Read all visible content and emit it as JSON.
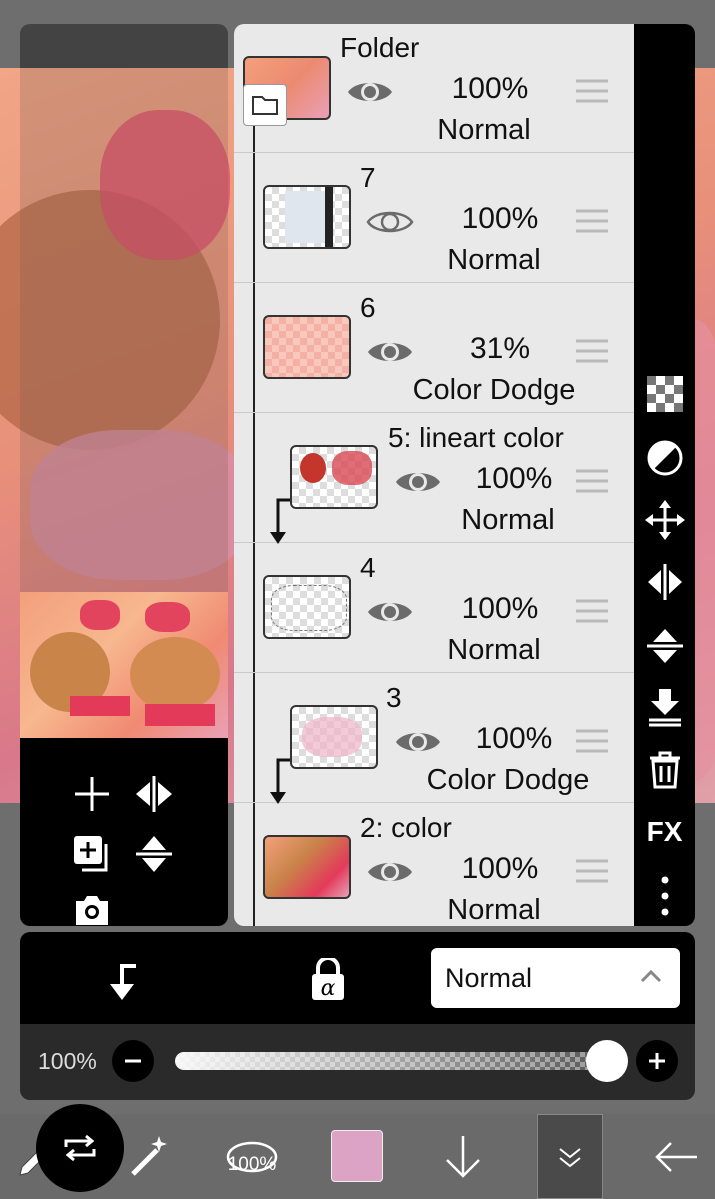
{
  "colors": {
    "panel_bg": "#e9e9e9",
    "toolbar_bg": "#000000",
    "current_color": "#dca3c4"
  },
  "layers": [
    {
      "name": "Folder",
      "opacity": "100%",
      "blend": "Normal",
      "is_folder": true,
      "visible": true
    },
    {
      "name": "7",
      "opacity": "100%",
      "blend": "Normal",
      "visible": false
    },
    {
      "name": "6",
      "opacity": "31%",
      "blend": "Color Dodge",
      "visible": true
    },
    {
      "name": "5: lineart color",
      "opacity": "100%",
      "blend": "Normal",
      "clipped": true,
      "visible": true
    },
    {
      "name": "4",
      "opacity": "100%",
      "blend": "Normal",
      "visible": true
    },
    {
      "name": "3",
      "opacity": "100%",
      "blend": "Color Dodge",
      "clipped": true,
      "visible": true
    },
    {
      "name": "2: color",
      "opacity": "100%",
      "blend": "Normal",
      "visible": true
    }
  ],
  "right_toolbar": {
    "fx_label": "FX"
  },
  "action_bar": {
    "blend_mode": "Normal"
  },
  "opacity_bar": {
    "label": "100%",
    "value": 1.0
  },
  "main_toolbar": {
    "brush_size_label": "100%"
  }
}
